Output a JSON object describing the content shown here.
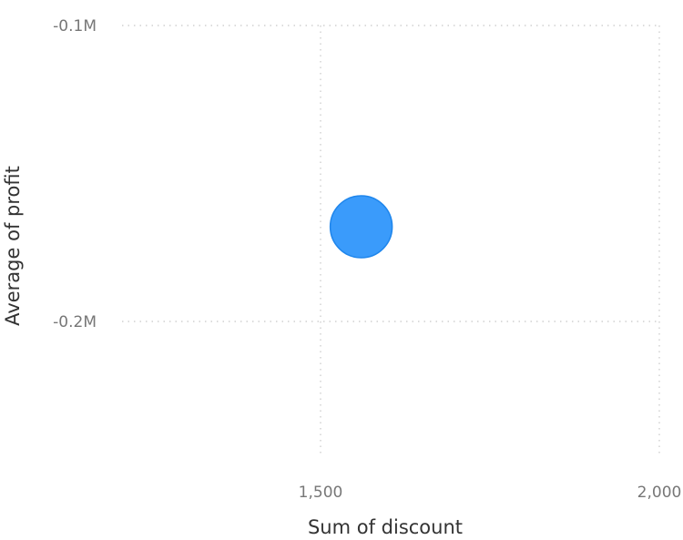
{
  "chart_data": {
    "type": "scatter",
    "xlabel": "Sum of discount",
    "ylabel": "Average of profit",
    "xlim": [
      1200,
      2000
    ],
    "ylim": [
      -240000,
      -100000
    ],
    "x_ticks": [
      {
        "value": 1500,
        "label": "1,500"
      },
      {
        "value": 2000,
        "label": "2,000"
      }
    ],
    "y_ticks": [
      {
        "value": -100000,
        "label": "-0.1M"
      },
      {
        "value": -200000,
        "label": "-0.2M"
      }
    ],
    "grid": true,
    "points": [
      {
        "x": 1560,
        "y": -168000
      }
    ],
    "marker_color": "#3a9bfb",
    "marker_edge_color": "#1f86ec"
  }
}
